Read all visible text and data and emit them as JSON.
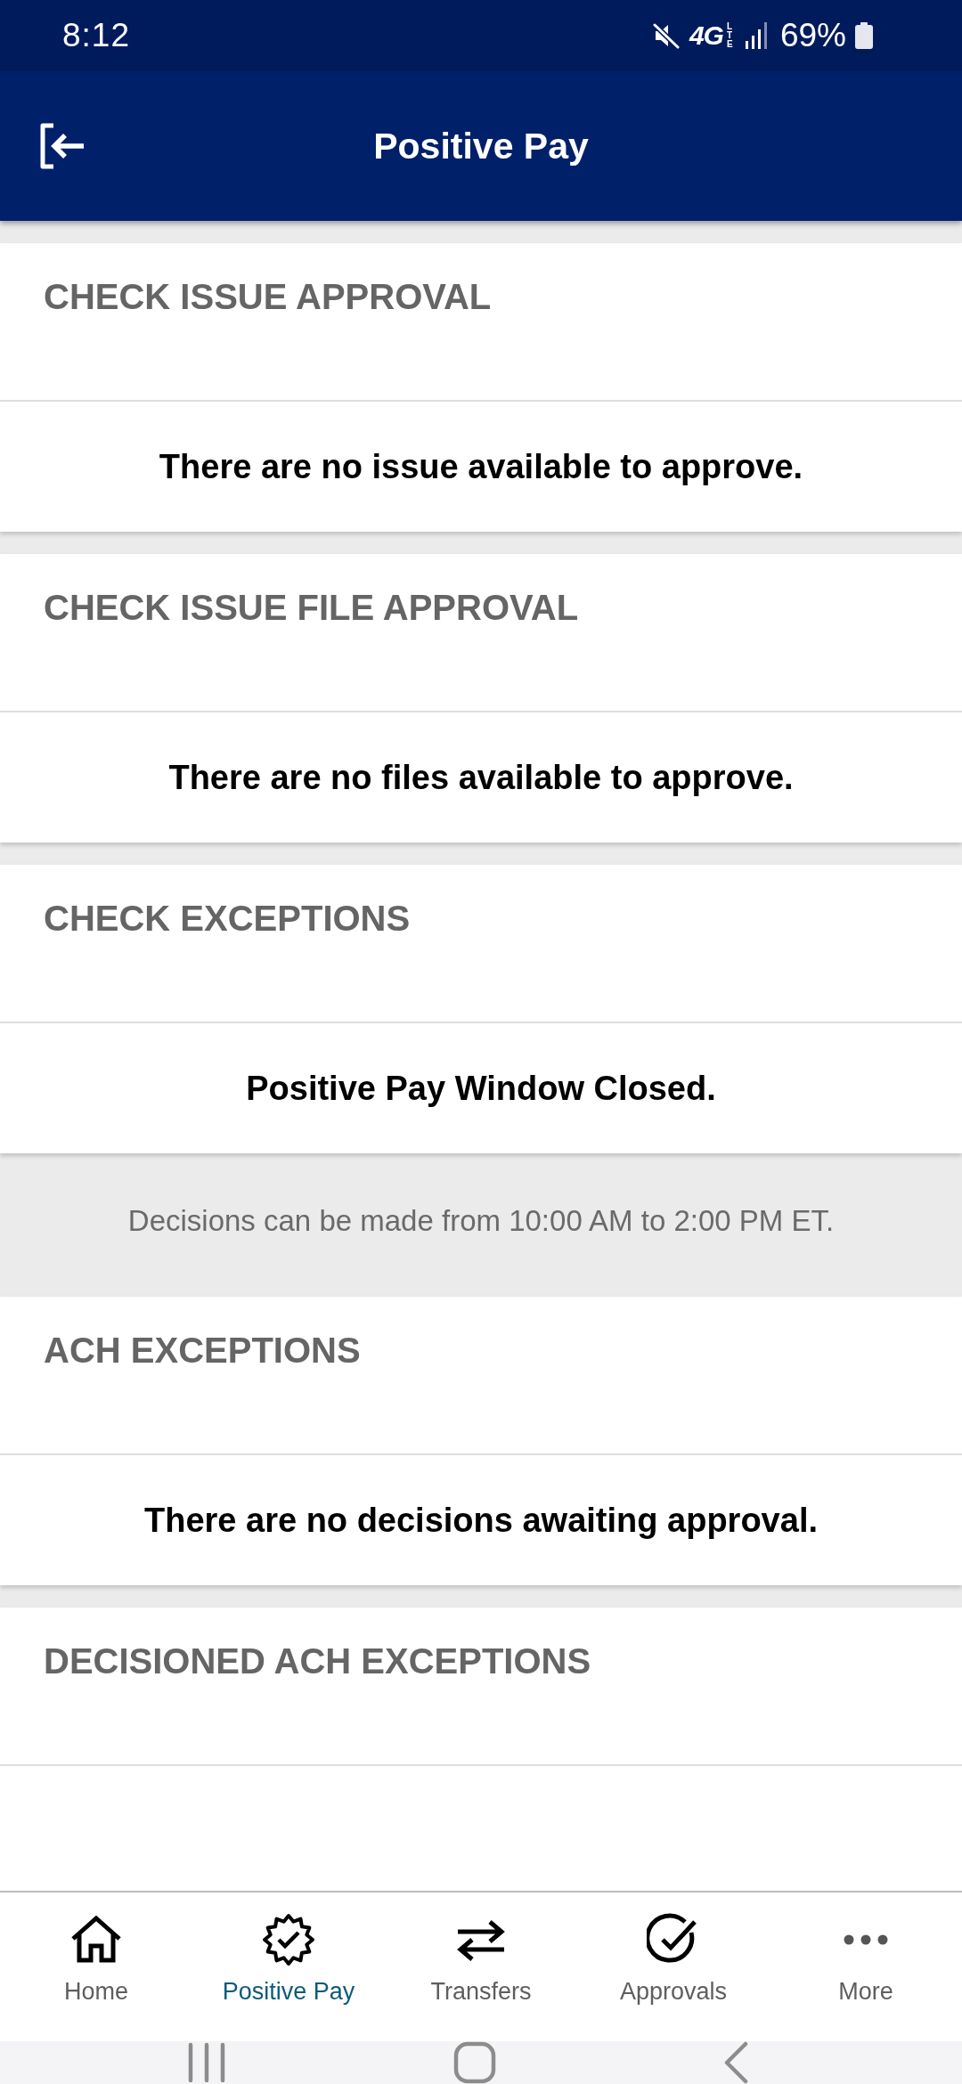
{
  "status_bar": {
    "time": "8:12",
    "network": "4G",
    "network_sub": "LTE",
    "battery": "69%"
  },
  "header": {
    "title": "Positive Pay"
  },
  "sections": [
    {
      "title": "CHECK ISSUE APPROVAL",
      "message": "There are no issue available to approve."
    },
    {
      "title": "CHECK ISSUE FILE APPROVAL",
      "message": "There are no files available to approve."
    },
    {
      "title": "CHECK EXCEPTIONS",
      "message": "Positive Pay Window Closed.",
      "notice": "Decisions can be made from 10:00 AM to 2:00 PM ET."
    },
    {
      "title": "ACH EXCEPTIONS",
      "message": "There are no decisions awaiting approval."
    },
    {
      "title": "DECISIONED ACH EXCEPTIONS"
    }
  ],
  "bottom_nav": [
    {
      "label": "Home",
      "selected": false
    },
    {
      "label": "Positive Pay",
      "selected": true
    },
    {
      "label": "Transfers",
      "selected": false
    },
    {
      "label": "Approvals",
      "selected": false
    },
    {
      "label": "More",
      "selected": false
    }
  ]
}
